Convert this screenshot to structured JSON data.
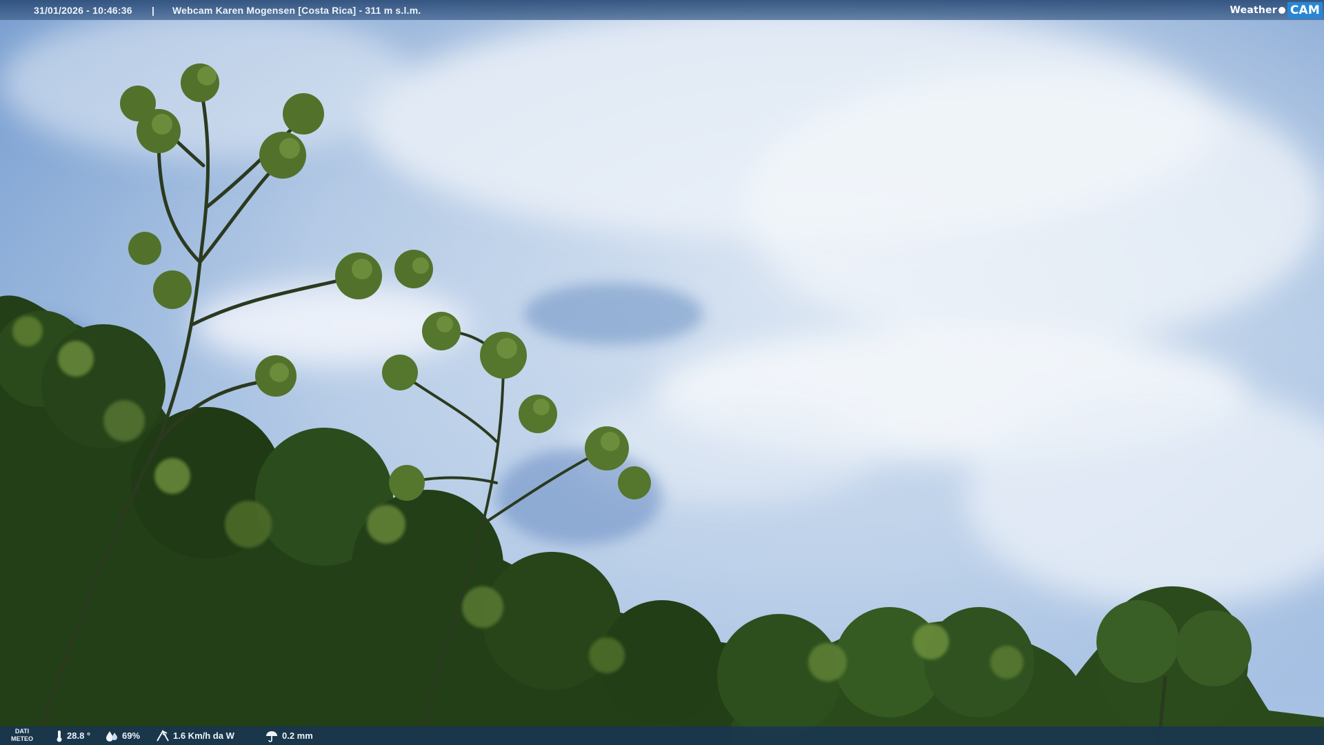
{
  "overlay": {
    "datetime": "31/01/2026 - 10:46:36",
    "separator": "|",
    "location": "Webcam Karen Mogensen [Costa Rica] - 311 m s.l.m.",
    "logo": {
      "word1": "Weather",
      "word2": "CAM"
    }
  },
  "weather": {
    "label_line1": "DATI",
    "label_line2": "METEO",
    "temperature": "28.8 °",
    "humidity": "69%",
    "wind": "1.6 Km/h da W",
    "rain": "0.2 mm"
  },
  "colors": {
    "sky_top": "#6f95c8",
    "sky_cloud": "#e6edf6",
    "foliage_dark": "#1f3a16",
    "foliage_light": "#6f8f3a",
    "bar_top": "#2d4e7a",
    "bar_bottom": "#183455",
    "logo_accent": "#2a86d4"
  },
  "icons": [
    "thermometer-icon",
    "humidity-drop-icon",
    "wind-icon",
    "rain-icon"
  ]
}
